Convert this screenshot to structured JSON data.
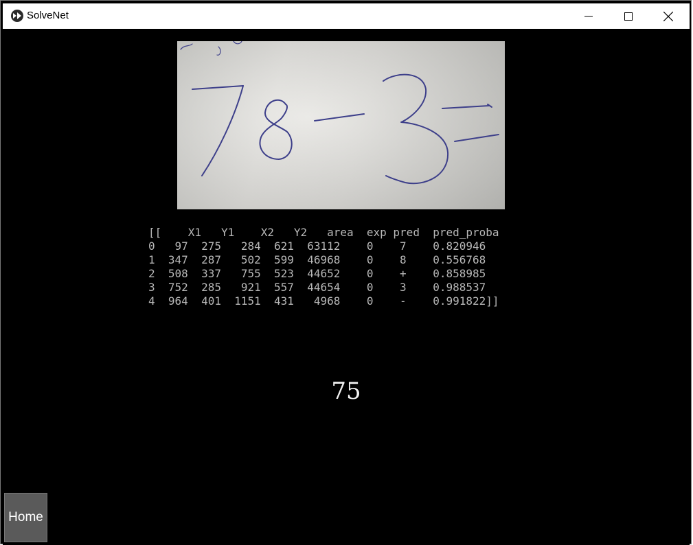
{
  "window": {
    "title": "SolveNet",
    "icon": "kivy-app-icon",
    "controls": [
      "minimize-icon",
      "maximize-icon",
      "close-icon"
    ]
  },
  "camera": {
    "description_icon": "camera-frame",
    "handwritten_expression": "78-3="
  },
  "table": {
    "text": "[[    X1   Y1    X2   Y2   area  exp pred  pred_proba\n0   97  275   284  621  63112    0    7    0.820946\n1  347  287   502  599  46968    0    8    0.556768\n2  508  337   755  523  44652    0    +    0.858985\n3  752  285   921  557  44654    0    3    0.988537\n4  964  401  1151  431   4968    0    -    0.991822]]"
  },
  "result": {
    "value": "75"
  },
  "home": {
    "label": "Home"
  }
}
